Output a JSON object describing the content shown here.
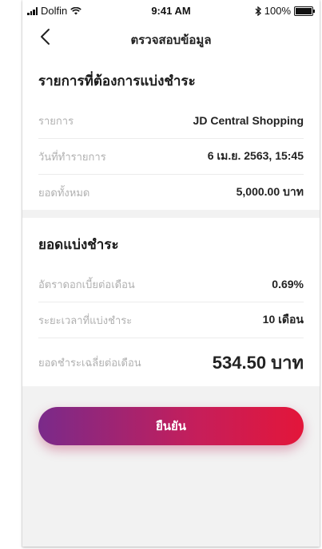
{
  "status_bar": {
    "carrier": "Dolfin",
    "time": "9:41 AM",
    "battery": "100%"
  },
  "nav": {
    "title": "ตรวจสอบข้อมูล"
  },
  "transaction": {
    "title": "รายการที่ต้องการแบ่งชำระ",
    "rows": [
      {
        "label": "รายการ",
        "value": "JD Central Shopping"
      },
      {
        "label": "วันที่ทำรายการ",
        "value": "6 เม.ย. 2563, 15:45"
      },
      {
        "label": "ยอดทั้งหมด",
        "value": "5,000.00 บาท"
      }
    ]
  },
  "installment": {
    "title": "ยอดแบ่งชำระ",
    "rows": [
      {
        "label": "อัตราดอกเบี้ยต่อเดือน",
        "value": "0.69%"
      },
      {
        "label": "ระยะเวลาที่แบ่งชำระ",
        "value": "10 เดือน"
      },
      {
        "label": "ยอดชำระเฉลี่ยต่อเดือน",
        "value": "534.50 บาท"
      }
    ]
  },
  "actions": {
    "confirm_label": "ยืนยัน"
  },
  "colors": {
    "gradient_start": "#7a2a8a",
    "gradient_end": "#e3163a"
  }
}
